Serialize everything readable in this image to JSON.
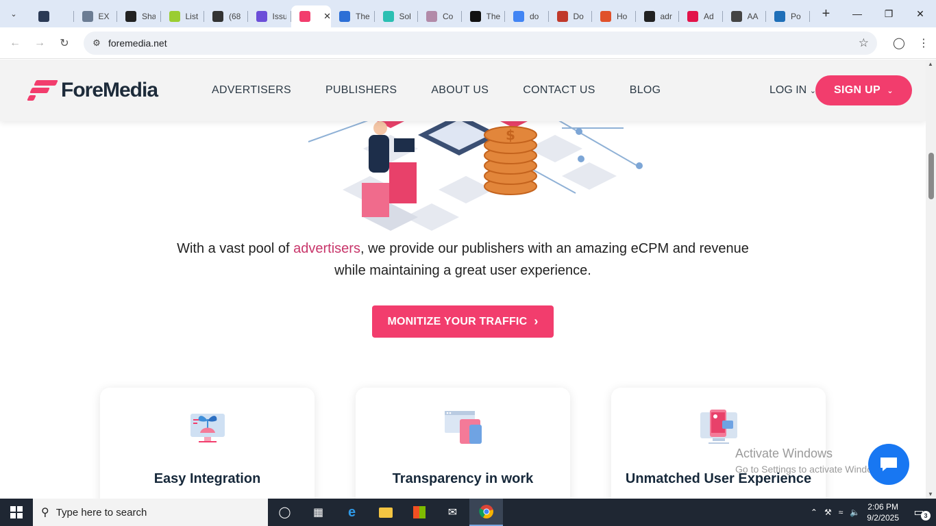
{
  "browser": {
    "tabs": [
      {
        "label": "",
        "icon": "layers-icon",
        "color": "#2b3a55"
      },
      {
        "label": "EX",
        "icon": "exch-icon",
        "color": "#6b7c93"
      },
      {
        "label": "Sha",
        "icon": "chatgpt-icon",
        "color": "#222222"
      },
      {
        "label": "List",
        "icon": "w-icon",
        "color": "#9acd32"
      },
      {
        "label": "(68",
        "icon": "b-icon",
        "color": "#333333"
      },
      {
        "label": "Issu",
        "icon": "e-icon",
        "color": "#6c4ed8"
      },
      {
        "label": "",
        "icon": "foremedia-icon",
        "color": "#f23d6d",
        "active": true
      },
      {
        "label": "The",
        "icon": "p-icon",
        "color": "#2c6fd6"
      },
      {
        "label": "Sol",
        "icon": "spiral-icon",
        "color": "#2bbfb2"
      },
      {
        "label": "Co",
        "icon": "c-icon",
        "color": "#b28aa8"
      },
      {
        "label": "The",
        "icon": "slash-icon",
        "color": "#111111"
      },
      {
        "label": "do",
        "icon": "google-icon",
        "color": "#4285f4"
      },
      {
        "label": "Do",
        "icon": "a-icon",
        "color": "#c0392b"
      },
      {
        "label": "Ho",
        "icon": "c2-icon",
        "color": "#e0512b"
      },
      {
        "label": "adr",
        "icon": "ad-icon",
        "color": "#222222"
      },
      {
        "label": "Ad",
        "icon": "a2-icon",
        "color": "#e2134a"
      },
      {
        "label": "AA",
        "icon": "aa-icon",
        "color": "#444444"
      },
      {
        "label": "Po",
        "icon": "xf-icon",
        "color": "#1f6fb8"
      }
    ],
    "url": "foremedia.net"
  },
  "site": {
    "brand": "ForeMedia",
    "nav": [
      "ADVERTISERS",
      "PUBLISHERS",
      "ABOUT US",
      "CONTACT US",
      "BLOG"
    ],
    "login": "LOG IN",
    "signup": "SIGN UP",
    "lead_before": "With a vast pool of ",
    "lead_link": "advertisers",
    "lead_after": ", we provide our publishers with an amazing eCPM and revenue",
    "lead_line2": "while maintaining a great user experience.",
    "cta": "MONITIZE YOUR TRAFFIC",
    "cards": [
      {
        "title": "Easy Integration",
        "icon": "plant-monitor-icon"
      },
      {
        "title": "Transparency in work",
        "icon": "windows-devices-icon"
      },
      {
        "title": "Unmatched User Experience",
        "icon": "monitor-phone-icon"
      }
    ],
    "brand_color": "#f23d6d"
  },
  "overlay": {
    "activate_title": "Activate Windows",
    "activate_sub": "Go to Settings to activate Windows."
  },
  "taskbar": {
    "search_placeholder": "Type here to search",
    "time": "2:06 PM",
    "date": "9/2/2025",
    "notifications": "3"
  }
}
